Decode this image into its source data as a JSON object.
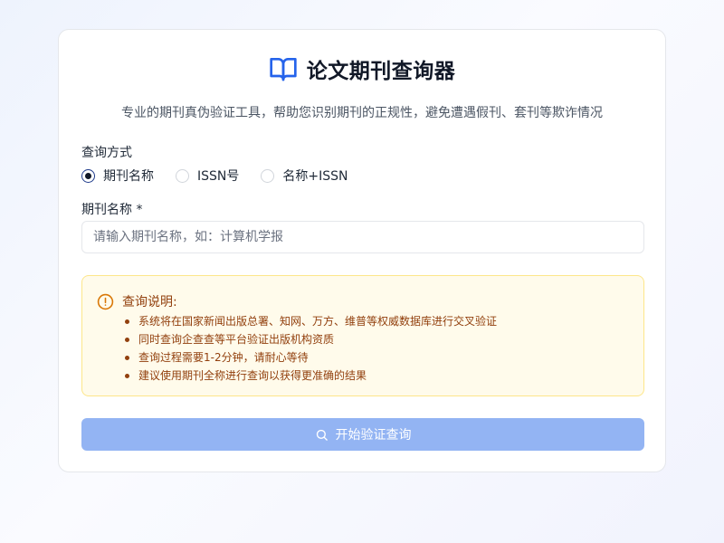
{
  "header": {
    "title": "论文期刊查询器",
    "subtitle": "专业的期刊真伪验证工具，帮助您识别期刊的正规性，避免遭遇假刊、套刊等欺诈情况",
    "icon": "book-open-icon"
  },
  "form": {
    "method_label": "查询方式",
    "methods": [
      {
        "label": "期刊名称",
        "checked": true
      },
      {
        "label": "ISSN号",
        "checked": false
      },
      {
        "label": "名称+ISSN",
        "checked": false
      }
    ],
    "name_label": "期刊名称 *",
    "name_placeholder": "请输入期刊名称，如：计算机学报",
    "name_value": ""
  },
  "notice": {
    "icon": "alert-circle-icon",
    "title": "查询说明:",
    "items": [
      "系统将在国家新闻出版总署、知网、万方、维普等权威数据库进行交叉验证",
      "同时查询企查查等平台验证出版机构资质",
      "查询过程需要1-2分钟，请耐心等待",
      "建议使用期刊全称进行查询以获得更准确的结果"
    ]
  },
  "submit": {
    "label": "开始验证查询",
    "icon": "search-icon"
  },
  "colors": {
    "accent": "#2563eb",
    "button_bg": "#93b4f3",
    "notice_bg": "#fffbeb",
    "notice_border": "#fde68a",
    "notice_text": "#92400e"
  }
}
